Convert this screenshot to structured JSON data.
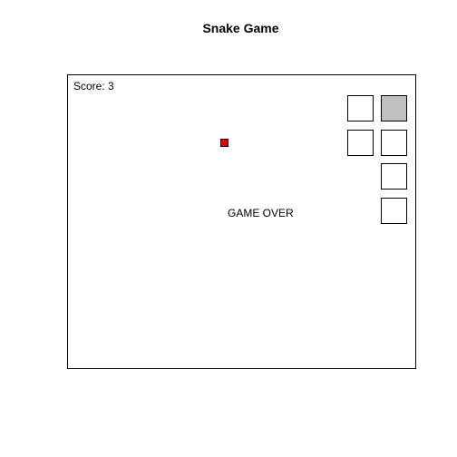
{
  "title": "Snake Game",
  "score_text": "Score: 3",
  "status_text": "GAME OVER",
  "colors": {
    "snake_head": "#c0c0c0",
    "snake_body": "#ffffff",
    "food": "#dd0000",
    "outline": "#000000"
  }
}
